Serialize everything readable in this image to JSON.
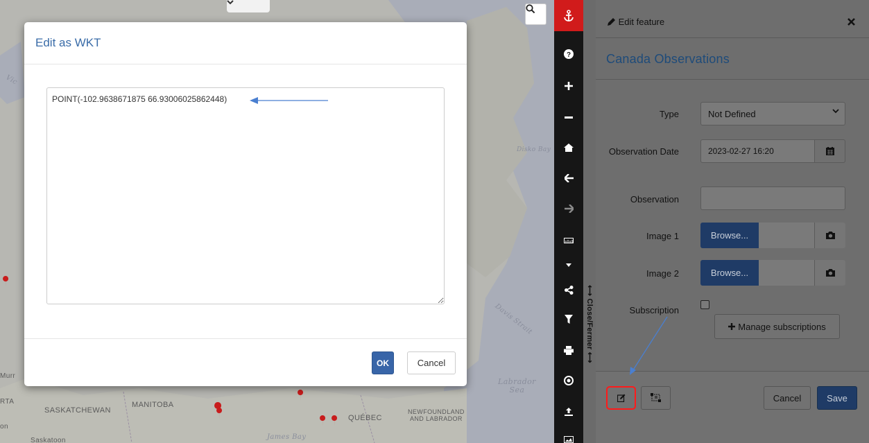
{
  "map": {
    "labels": {
      "saskatchewan": "SASKATCHEWAN",
      "manitoba": "MANITOBA",
      "quebec": "QUÉBEC",
      "newfoundland": "NEWFOUNDLAND\nAND LABRADOR",
      "james_bay": "James Bay",
      "labrador_sea": "Labrador\nSea",
      "davis_strait": "Davis Strait",
      "disko_bay": "Disko Bay",
      "rta": "RTA",
      "murr": "Murr",
      "on": "on",
      "saskatoon": "Saskatoon",
      "vic": "Vic"
    },
    "search_icon": "search-icon",
    "collapse_icon": "chevron-down-icon"
  },
  "dialog": {
    "title": "Edit as WKT",
    "wkt_value": "POINT(-102.9638671875 66.93006025862448)",
    "ok_label": "OK",
    "cancel_label": "Cancel"
  },
  "toolbar": {
    "items": [
      "anchor-icon",
      "question-icon",
      "zoom-in-icon",
      "zoom-out-icon",
      "home-icon",
      "arrow-left-icon",
      "arrow-right-icon",
      "ruler-icon",
      "caret-down-icon",
      "share-icon",
      "filter-icon",
      "print-icon",
      "target-icon",
      "upload-icon",
      "image-icon"
    ],
    "active_color": "#d11b1b"
  },
  "side_panel": {
    "close_strip_label": "⟷ Close/Fermer ⟷",
    "header_title": "Edit feature",
    "title": "Canada Observations",
    "type_label": "Type",
    "type_value": "Not Defined",
    "date_label": "Observation Date",
    "date_value": "2023-02-27 16:20",
    "observation_label": "Observation",
    "observation_value": "",
    "image1_label": "Image 1",
    "image2_label": "Image 2",
    "browse_label": "Browse...",
    "subscription_label": "Subscription",
    "manage_subscriptions_label": "Manage subscriptions",
    "cancel_label": "Cancel",
    "save_label": "Save"
  },
  "colors": {
    "accent": "#3865a8",
    "title_blue": "#3a6ca8",
    "highlight_red": "#ff1a1a",
    "arrow_blue": "#4a7fd0"
  }
}
